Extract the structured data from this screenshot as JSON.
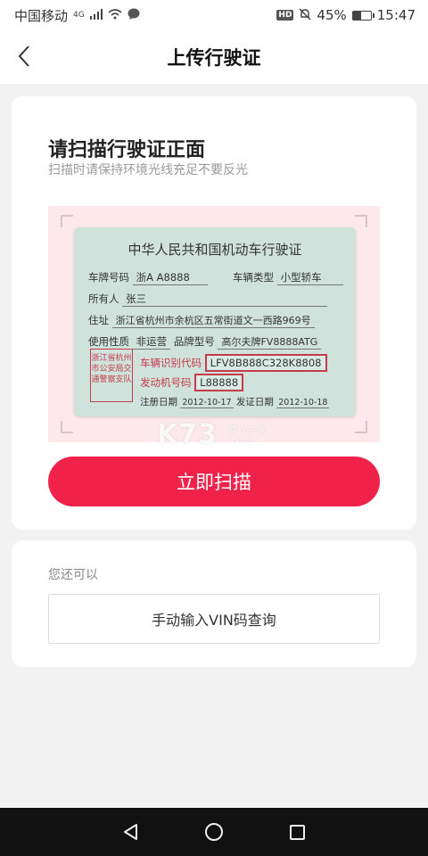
{
  "status_bar": {
    "carrier": "中国移动",
    "network": "4G",
    "battery": "45%",
    "battery_level": 0.45,
    "time": "15:47"
  },
  "nav": {
    "title": "上传行驶证"
  },
  "scan_card": {
    "title": "请扫描行驶证正面",
    "subtitle": "扫描时请保持环境光线充足不要反光",
    "button_label": "立即扫描",
    "accent_color": "#f0224a"
  },
  "license": {
    "title": "中华人民共和国机动车行驶证",
    "plate_label": "车牌号码",
    "plate_value": "浙A A8888",
    "type_label": "车辆类型",
    "type_value": "小型轿车",
    "owner_label": "所有人",
    "owner_value": "张三",
    "address_label": "住址",
    "address_value": "浙江省杭州市余杭区五常街道文一西路969号",
    "usage_label": "使用性质",
    "usage_value": "非运营",
    "model_label": "品牌型号",
    "model_value": "高尔夫牌FV8888ATG",
    "vin_label": "车辆识别代码",
    "vin_value": "LFV8B888C328K8808",
    "engine_label": "发动机号码",
    "engine_value": "L88888",
    "reg_date_label": "注册日期",
    "reg_date_value": "2012-10-17",
    "issue_date_label": "发证日期",
    "issue_date_value": "2012-10-18",
    "seal_text": "浙江省杭州市公安局交通警察支队"
  },
  "alt_card": {
    "label": "您还可以",
    "vin_button_label": "手动输入VIN码查询"
  },
  "watermark": {
    "brand": "K73",
    "sub_line1": "游戏之家",
    "sub_line2": ".com"
  }
}
